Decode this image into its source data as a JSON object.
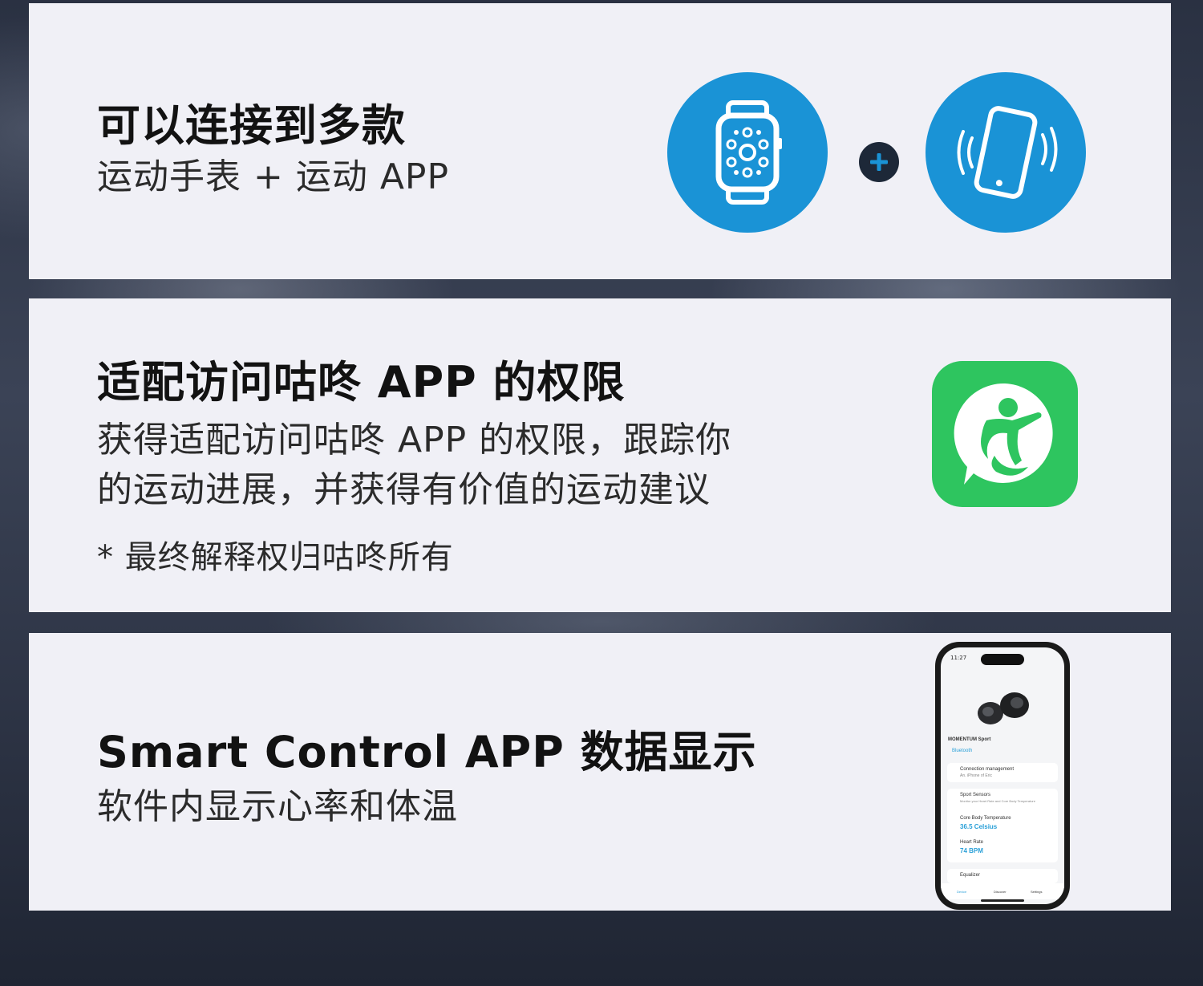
{
  "cards": [
    {
      "title": "可以连接到多款",
      "subtitle": "运动手表 + 运动 APP",
      "icons": [
        "smartwatch-icon",
        "plus-icon",
        "vibrating-phone-icon"
      ]
    },
    {
      "title": "适配访问咕咚 APP 的权限",
      "lines": [
        "获得适配访问咕咚 APP 的权限，跟踪你",
        "的运动进展，并获得有价值的运动建议"
      ],
      "note": "* 最终解释权归咕咚所有",
      "icon": "codoon-app-icon"
    },
    {
      "title": "Smart Control APP 数据显示",
      "subtitle": "软件内显示心率和体温",
      "phone": {
        "time": "11:27",
        "product_name": "MOMENTUM Sport",
        "bluetooth_label": "Bluetooth",
        "rows": [
          {
            "label": "Connection management",
            "sub": "An.  iPhone of Eric"
          },
          {
            "label": "Sport Sensors",
            "sub": "Monitor your Heart Rate and Core Body Temperature"
          },
          {
            "label": "Core Body Temperature",
            "value": "36.5 Celsius"
          },
          {
            "label": "Heart Rate",
            "value": "74 BPM"
          },
          {
            "label": "Equalizer",
            "sub": ""
          }
        ],
        "tabs": [
          "Device",
          "Discover",
          "Settings"
        ]
      }
    }
  ],
  "colors": {
    "card_bg": "#f0f0f6",
    "circle_blue": "#1a93d6",
    "codoon_green": "#2ec55f",
    "title_text": "#121212",
    "body_text": "#2b2b2b"
  }
}
